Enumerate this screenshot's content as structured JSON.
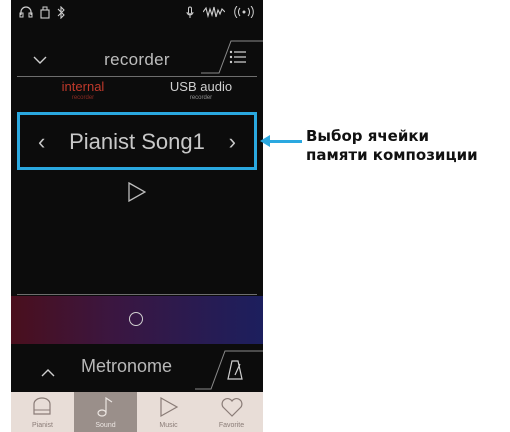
{
  "status_icons": [
    "headphones-icon",
    "usb-icon",
    "bluetooth-icon",
    "microphone-icon",
    "waveform-icon",
    "wireless-icon"
  ],
  "header": {
    "title": "recorder",
    "chevron": "chevron-down-icon",
    "menu": "menu-icon"
  },
  "tabs": [
    {
      "label": "internal",
      "sub": "recorder",
      "active": true,
      "color": "#c0392b"
    },
    {
      "label": "USB audio",
      "sub": "recorder",
      "active": false,
      "color": "#cfcfcf"
    }
  ],
  "song_selector": {
    "song": "Pianist Song1",
    "prev": "‹",
    "next": "›",
    "highlight_color": "#2aa8e0"
  },
  "metronome": {
    "title": "Metronome",
    "chevron": "chevron-up-icon",
    "icon": "metronome-icon"
  },
  "bottom_nav": [
    {
      "label": "Pianist",
      "icon": "piano-icon",
      "active": false
    },
    {
      "label": "Sound",
      "icon": "music-note-icon",
      "active": true
    },
    {
      "label": "Music",
      "icon": "play-icon",
      "active": false
    },
    {
      "label": "Favorite",
      "icon": "heart-icon",
      "active": false
    }
  ],
  "callout": {
    "line1": "Выбор ячейки",
    "line2": "памяти композиции"
  }
}
